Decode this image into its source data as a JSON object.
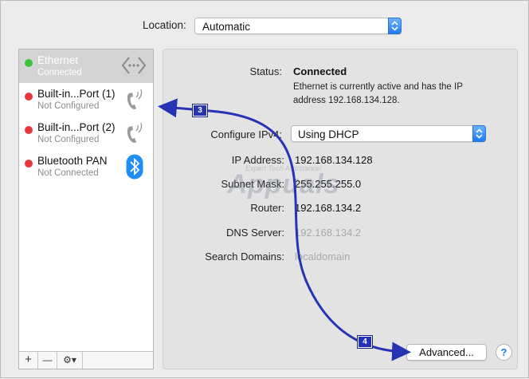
{
  "location": {
    "label": "Location:",
    "value": "Automatic"
  },
  "services": [
    {
      "name": "Ethernet",
      "status": "Connected",
      "dot_color": "#3cc13b",
      "icon": "ethernet-arrows-icon",
      "selected": true
    },
    {
      "name": "Built-in...Port (1)",
      "status": "Not Configured",
      "dot_color": "#e8373b",
      "icon": "phone-icon",
      "selected": false
    },
    {
      "name": "Built-in...Port (2)",
      "status": "Not Configured",
      "dot_color": "#e8373b",
      "icon": "phone-icon",
      "selected": false
    },
    {
      "name": "Bluetooth PAN",
      "status": "Not Connected",
      "dot_color": "#e8373b",
      "icon": "bluetooth-icon",
      "selected": false
    }
  ],
  "sidebar_bar": {
    "add": "+",
    "remove": "—",
    "action": "⚙▾"
  },
  "detail": {
    "status_label": "Status:",
    "status_value": "Connected",
    "status_desc": "Ethernet is currently active and has the IP address 192.168.134.128.",
    "configure_label": "Configure IPv4:",
    "configure_value": "Using DHCP",
    "ip_label": "IP Address:",
    "ip_value": "192.168.134.128",
    "subnet_label": "Subnet Mask:",
    "subnet_value": "255.255.255.0",
    "router_label": "Router:",
    "router_value": "192.168.134.2",
    "dns_label": "DNS Server:",
    "dns_value": "192.168.134.2",
    "search_label": "Search Domains:",
    "search_value": "localdomain",
    "advanced_button": "Advanced...",
    "help_button": "?"
  },
  "annotations": {
    "badge_3": "3",
    "badge_4": "4",
    "color": "#2634b4"
  },
  "watermark": {
    "tag": "Expert Tech Assistance!",
    "brand": "Appuals"
  }
}
